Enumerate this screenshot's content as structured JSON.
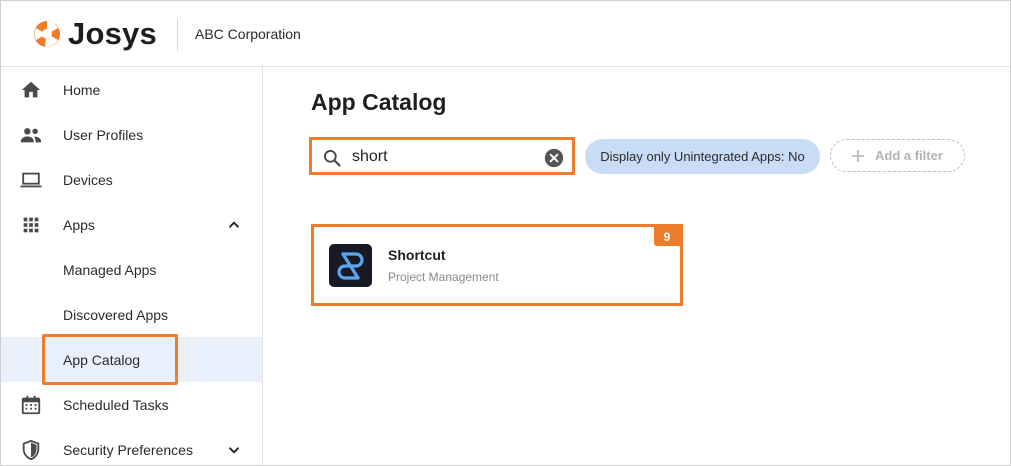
{
  "header": {
    "brand": "Josys",
    "org_name": "ABC Corporation"
  },
  "sidebar": {
    "items": [
      {
        "label": "Home",
        "icon": "home-icon"
      },
      {
        "label": "User Profiles",
        "icon": "people-icon"
      },
      {
        "label": "Devices",
        "icon": "laptop-icon"
      },
      {
        "label": "Apps",
        "icon": "grid-icon",
        "expanded": true
      },
      {
        "label": "Managed Apps"
      },
      {
        "label": "Discovered Apps"
      },
      {
        "label": "App Catalog",
        "active": true
      },
      {
        "label": "Scheduled Tasks",
        "icon": "calendar-icon"
      },
      {
        "label": "Security Preferences",
        "icon": "shield-icon",
        "expanded": false
      }
    ]
  },
  "main": {
    "title": "App Catalog",
    "search": {
      "value": "short",
      "placeholder": ""
    },
    "filter_chip": "Display only Unintegrated Apps: No",
    "add_filter": "Add a filter",
    "apps": [
      {
        "name": "Shortcut",
        "category": "Project Management",
        "badge": "9"
      }
    ]
  },
  "colors": {
    "accent_orange": "#ee7d2b",
    "chip_blue": "#c9dcf6",
    "active_bg": "#eaf0fb"
  }
}
